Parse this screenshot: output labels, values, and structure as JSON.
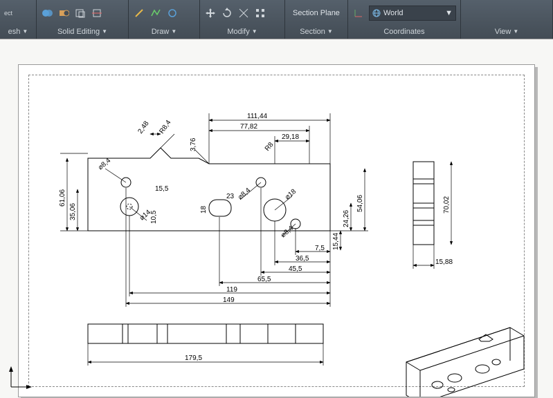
{
  "ribbon": {
    "panels": [
      {
        "key": "mesh",
        "label": "esh",
        "dropdown": true
      },
      {
        "key": "solid_editing",
        "label": "Solid Editing",
        "dropdown": true
      },
      {
        "key": "draw",
        "label": "Draw",
        "dropdown": true
      },
      {
        "key": "modify",
        "label": "Modify",
        "dropdown": true
      },
      {
        "key": "section",
        "label": "Section",
        "dropdown": true,
        "big_label": "Section Plane"
      },
      {
        "key": "coordinates",
        "label": "Coordinates",
        "coord_value": "World"
      },
      {
        "key": "view",
        "label": "View",
        "dropdown": true
      }
    ],
    "partial_left": "ect"
  },
  "drawing": {
    "dimensions": {
      "d_111_44": "111,44",
      "d_77_82": "77,82",
      "d_29_18": "29,18",
      "d_2_48": "2,48",
      "r8_4": "R8,4",
      "d_3_76": "3,76",
      "r8": "R8",
      "dia_8_4": "⌀8,4",
      "d_15_5": "15,5",
      "d_23": "23",
      "dia_8_4b": "⌀8,4",
      "dia_18": "⌀18",
      "dia_14": "⌀14",
      "d_10_5": "10,5",
      "d_18": "18",
      "dia_8_4c": "⌀8,4",
      "d_7_5": "7,5",
      "d_36_5": "36,5",
      "d_45_5": "45,5",
      "d_65_5": "65,5",
      "d_119": "119",
      "d_149": "149",
      "d_61_06": "61,06",
      "d_35_06": "35,06",
      "d_24_26": "24,26",
      "d_54_06": "54,06",
      "d_15_44": "15,44",
      "d_70_02": "70,02",
      "d_15_88": "15,88",
      "d_179_5": "179,5"
    }
  }
}
